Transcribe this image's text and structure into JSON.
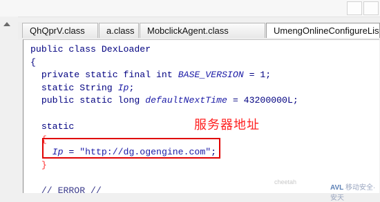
{
  "tabs": [
    {
      "label": "QhQprV.class",
      "active": false
    },
    {
      "label": "a.class",
      "active": false
    },
    {
      "label": "MobclickAgent.class",
      "active": false
    },
    {
      "label": "UmengOnlineConfigureList",
      "active": true
    }
  ],
  "code": {
    "line1": "public class DexLoader",
    "line2": "{",
    "line3_prefix": "  private static final int ",
    "line3_var": "BASE_VERSION",
    "line3_suffix": " = 1;",
    "line4_prefix": "  static String ",
    "line4_var": "Ip",
    "line4_suffix": ";",
    "line5_prefix": "  public static long ",
    "line5_var": "defaultNextTime",
    "line5_suffix": " = 43200000L;",
    "line6": "  static",
    "line7": "  {",
    "line8_var": "    Ip",
    "line8_eq": " = ",
    "line8_str": "\"http://dg.ogengine.com\"",
    "line8_end": ";",
    "line9": "  }",
    "line10": "  // ERROR //"
  },
  "annotation": "服务器地址",
  "watermark": {
    "left": "cheetah",
    "right": "移动安全·安天",
    "right_prefix": "AVL"
  },
  "colors": {
    "code_text": "#000080",
    "annotation": "#ff2020",
    "highlight_box": "#e00000"
  }
}
